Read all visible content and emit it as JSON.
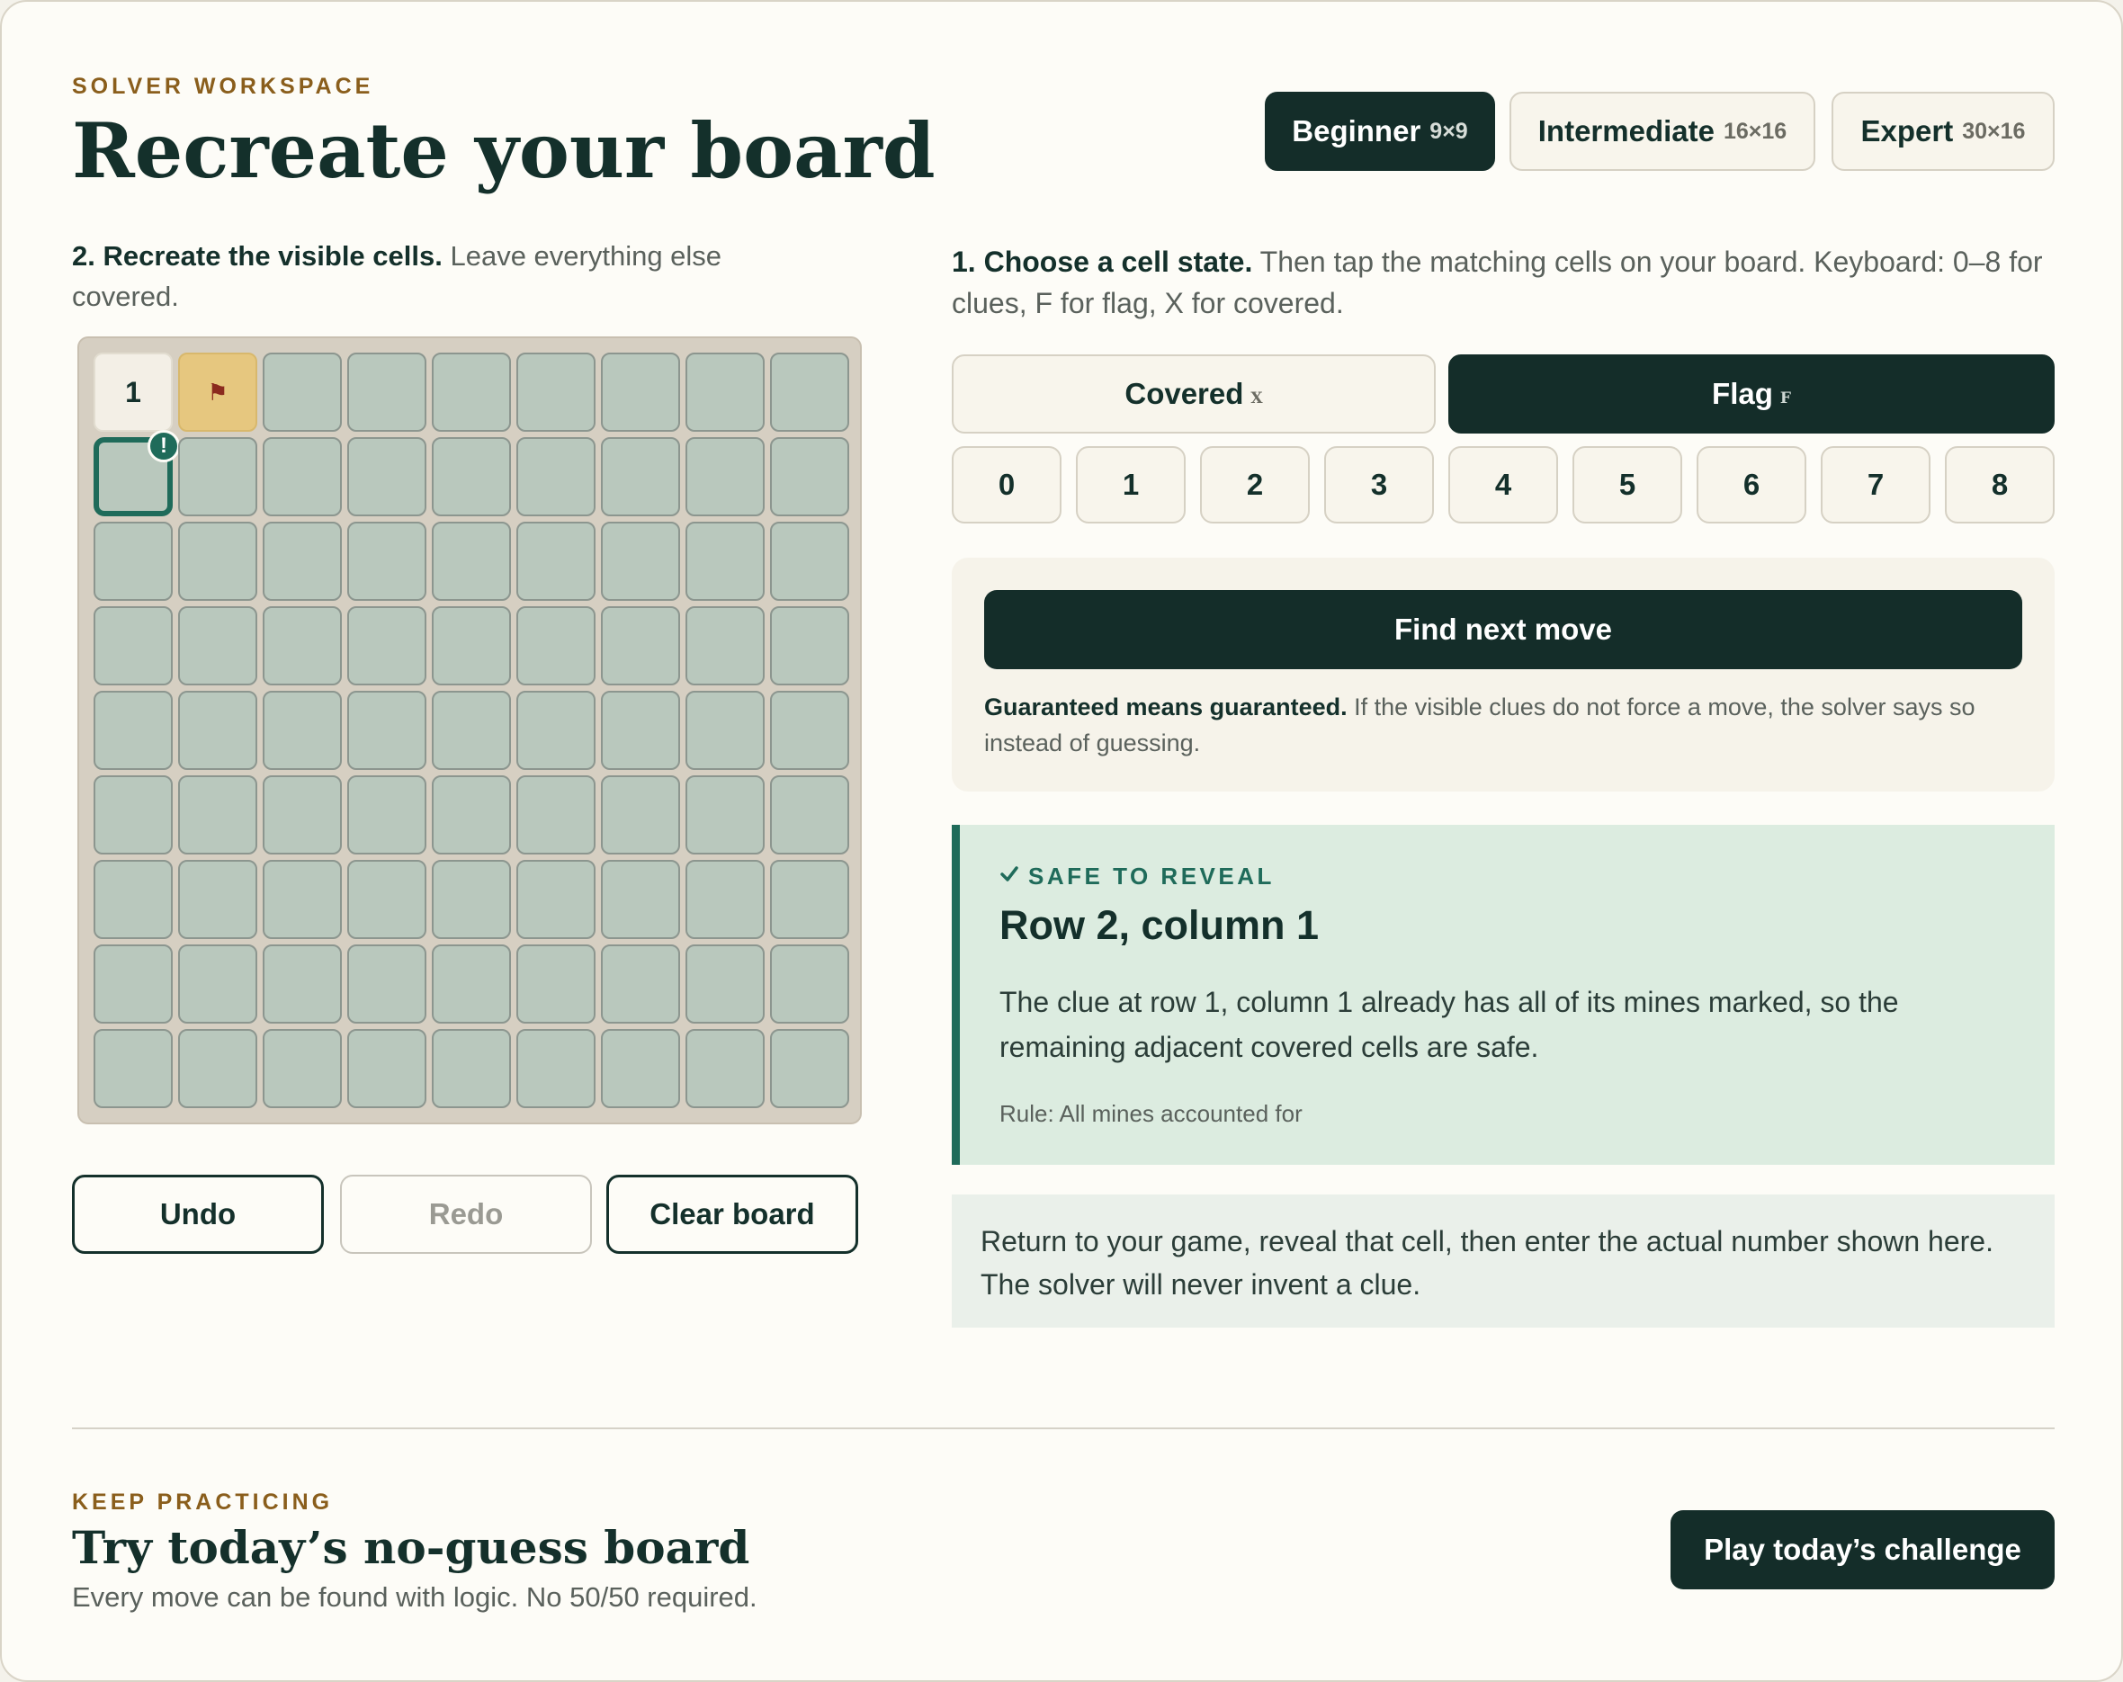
{
  "header": {
    "eyebrow": "SOLVER WORKSPACE",
    "title": "Recreate your board"
  },
  "difficulty": [
    {
      "label": "Beginner",
      "size": "9×9",
      "active": true
    },
    {
      "label": "Intermediate",
      "size": "16×16",
      "active": false
    },
    {
      "label": "Expert",
      "size": "30×16",
      "active": false
    }
  ],
  "step2": {
    "bold": "2. Recreate the visible cells.",
    "text": "Leave everything else covered."
  },
  "board": {
    "rows": 9,
    "cols": 9,
    "revealed": [
      {
        "row": 1,
        "col": 1,
        "value": "1"
      }
    ],
    "flags": [
      {
        "row": 1,
        "col": 2
      }
    ],
    "flag_glyph": "⚑",
    "target": {
      "row": 2,
      "col": 1
    },
    "target_badge": "!"
  },
  "controls": {
    "undo": "Undo",
    "redo": "Redo",
    "clear": "Clear board"
  },
  "step1": {
    "bold": "1. Choose a cell state.",
    "text": "Then tap the matching cells on your board. Keyboard: 0–8 for clues, F for flag, X for covered."
  },
  "states": {
    "covered": {
      "label": "Covered",
      "key": "X"
    },
    "flag": {
      "label": "Flag",
      "key": "F"
    },
    "numbers": [
      "0",
      "1",
      "2",
      "3",
      "4",
      "5",
      "6",
      "7",
      "8"
    ]
  },
  "find": {
    "button": "Find next move",
    "note_bold": "Guaranteed means guaranteed.",
    "note_text": "If the visible clues do not force a move, the solver says so instead of guessing."
  },
  "result": {
    "tag": "SAFE TO REVEAL",
    "title": "Row 2, column 1",
    "body": "The clue at row 1, column 1 already has all of its mines marked, so the remaining adjacent covered cells are safe.",
    "rule": "Rule: All mines accounted for"
  },
  "notice": "Return to your game, reveal that cell, then enter the actual number shown here. The solver will never invent a clue.",
  "footer": {
    "eyebrow": "KEEP PRACTICING",
    "title": "Try today’s no-guess board",
    "subtitle": "Every move can be found with logic. No 50/50 required.",
    "cta": "Play today’s challenge"
  },
  "colors": {
    "primary": "#142d29",
    "accent_green": "#1f6b5a",
    "eyebrow_gold": "#8a5e1c",
    "covered_cell": "#b9c8bd",
    "flag_cell": "#e6c77f",
    "result_bg": "#dcece0"
  }
}
